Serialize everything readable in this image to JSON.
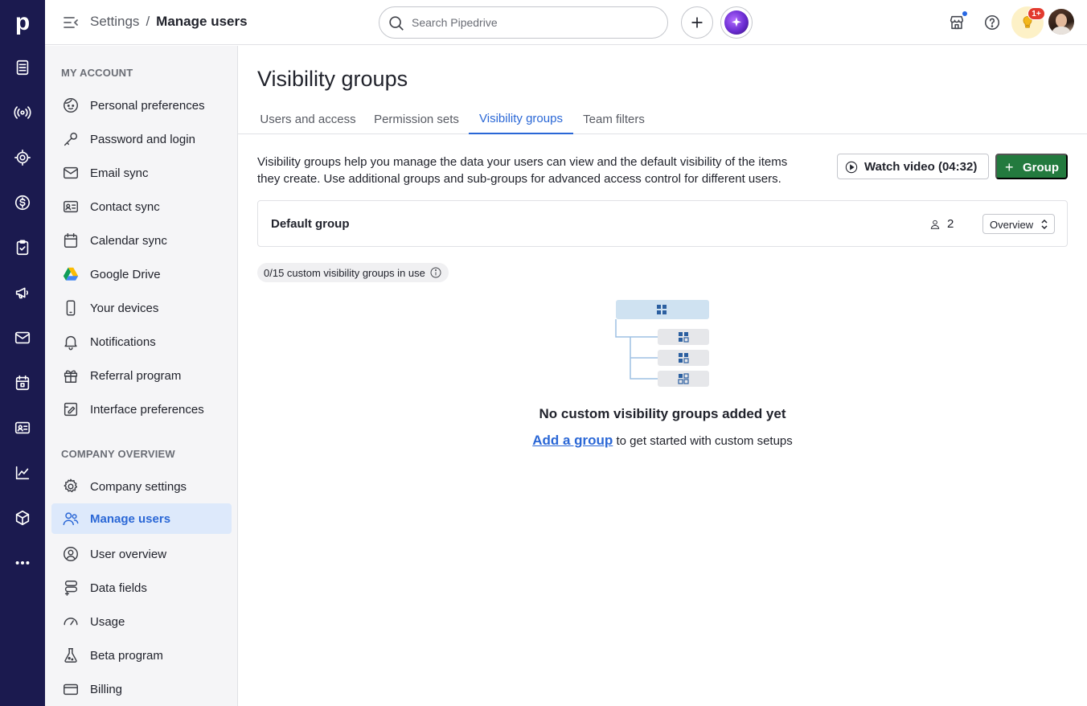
{
  "rail": {
    "logo": "p",
    "icons": [
      "leads-icon",
      "radar-icon",
      "target-icon",
      "dollar-icon",
      "tasks-icon",
      "megaphone-icon",
      "mail-icon",
      "calendar-icon",
      "contacts-icon",
      "chart-icon",
      "box-icon",
      "more-icon"
    ]
  },
  "topbar": {
    "breadcrumb_parent": "Settings",
    "breadcrumb_separator": "/",
    "breadcrumb_current": "Manage users",
    "search_placeholder": "Search Pipedrive",
    "tips_badge": "1+"
  },
  "sidebar": {
    "my_account_heading": "MY ACCOUNT",
    "my_account_items": [
      {
        "label": "Personal preferences",
        "icon": "face-icon"
      },
      {
        "label": "Password and login",
        "icon": "key-icon"
      },
      {
        "label": "Email sync",
        "icon": "envelope-icon"
      },
      {
        "label": "Contact sync",
        "icon": "contact-card-icon"
      },
      {
        "label": "Calendar sync",
        "icon": "calendar-icon"
      },
      {
        "label": "Google Drive",
        "icon": "google-drive-icon"
      },
      {
        "label": "Your devices",
        "icon": "phone-icon"
      },
      {
        "label": "Notifications",
        "icon": "bell-icon"
      },
      {
        "label": "Referral program",
        "icon": "gift-icon"
      },
      {
        "label": "Interface preferences",
        "icon": "interface-icon"
      }
    ],
    "company_heading": "COMPANY OVERVIEW",
    "company_items": [
      {
        "label": "Company settings",
        "icon": "gear-icon"
      },
      {
        "label": "Manage users",
        "icon": "users-icon",
        "active": true
      },
      {
        "label": "User overview",
        "icon": "user-circle-icon"
      },
      {
        "label": "Data fields",
        "icon": "data-fields-icon"
      },
      {
        "label": "Usage",
        "icon": "gauge-icon"
      },
      {
        "label": "Beta program",
        "icon": "flask-icon"
      },
      {
        "label": "Billing",
        "icon": "credit-card-icon"
      }
    ]
  },
  "main": {
    "title": "Visibility groups",
    "tabs": [
      "Users and access",
      "Permission sets",
      "Visibility groups",
      "Team filters"
    ],
    "active_tab": "Visibility groups",
    "description": "Visibility groups help you manage the data your users can view and the default visibility of the items they create. Use additional groups and sub-groups for advanced access control for different users.",
    "watch_video_label": "Watch video (04:32)",
    "add_group_label": "Group",
    "default_group": {
      "name": "Default group",
      "user_count": "2",
      "view_select": "Overview"
    },
    "usage_pill": "0/15 custom visibility groups in use",
    "empty_title": "No custom visibility groups added yet",
    "empty_link": "Add a group",
    "empty_suffix": " to get started with custom setups"
  },
  "colors": {
    "rail_bg": "#1b1a4f",
    "accent_blue": "#2a67d6",
    "primary_green": "#237a3e",
    "active_item_bg": "#dde9fb"
  }
}
